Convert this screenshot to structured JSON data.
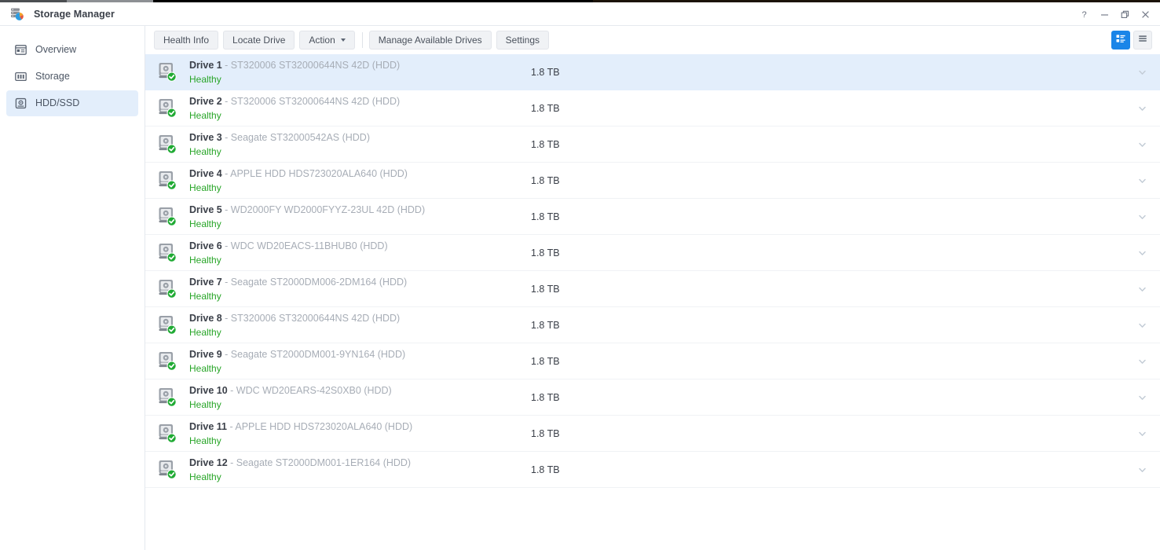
{
  "window": {
    "title": "Storage Manager",
    "app_icon": "storage-manager-icon",
    "controls": [
      {
        "name": "help-button",
        "glyph": "?"
      },
      {
        "name": "minimize-button",
        "glyph": "minimize-icon"
      },
      {
        "name": "maximize-button",
        "glyph": "maximize-icon"
      },
      {
        "name": "close-button",
        "glyph": "close-icon"
      }
    ]
  },
  "sidebar": {
    "items": [
      {
        "label": "Overview",
        "icon": "overview-icon",
        "active": false
      },
      {
        "label": "Storage",
        "icon": "storage-icon",
        "active": false
      },
      {
        "label": "HDD/SSD",
        "icon": "hdd-ssd-icon",
        "active": true
      }
    ]
  },
  "toolbar": {
    "health_info_label": "Health Info",
    "locate_drive_label": "Locate Drive",
    "action_label": "Action",
    "manage_available_drives_label": "Manage Available Drives",
    "settings_label": "Settings",
    "view_detail_icon": "detail-view-icon",
    "view_list_icon": "list-view-icon",
    "active_view": "detail"
  },
  "colors": {
    "accent": "#1a85e8",
    "selected_row": "#e3eefb",
    "healthy": "#27a527",
    "model_text": "#a7adb6",
    "primary_text": "#3b4049"
  },
  "drives": [
    {
      "name": "Drive 1",
      "model": "ST320006 ST32000644NS 42D (HDD)",
      "size": "1.8 TB",
      "status": "Healthy",
      "selected": true
    },
    {
      "name": "Drive 2",
      "model": "ST320006 ST32000644NS 42D (HDD)",
      "size": "1.8 TB",
      "status": "Healthy",
      "selected": false
    },
    {
      "name": "Drive 3",
      "model": "Seagate ST32000542AS (HDD)",
      "size": "1.8 TB",
      "status": "Healthy",
      "selected": false
    },
    {
      "name": "Drive 4",
      "model": "APPLE HDD HDS723020ALA640 (HDD)",
      "size": "1.8 TB",
      "status": "Healthy",
      "selected": false
    },
    {
      "name": "Drive 5",
      "model": "WD2000FY WD2000FYYZ-23UL 42D (HDD)",
      "size": "1.8 TB",
      "status": "Healthy",
      "selected": false
    },
    {
      "name": "Drive 6",
      "model": "WDC WD20EACS-11BHUB0 (HDD)",
      "size": "1.8 TB",
      "status": "Healthy",
      "selected": false
    },
    {
      "name": "Drive 7",
      "model": "Seagate ST2000DM006-2DM164 (HDD)",
      "size": "1.8 TB",
      "status": "Healthy",
      "selected": false
    },
    {
      "name": "Drive 8",
      "model": "ST320006 ST32000644NS 42D (HDD)",
      "size": "1.8 TB",
      "status": "Healthy",
      "selected": false
    },
    {
      "name": "Drive 9",
      "model": "Seagate ST2000DM001-9YN164 (HDD)",
      "size": "1.8 TB",
      "status": "Healthy",
      "selected": false
    },
    {
      "name": "Drive 10",
      "model": "WDC WD20EARS-42S0XB0 (HDD)",
      "size": "1.8 TB",
      "status": "Healthy",
      "selected": false
    },
    {
      "name": "Drive 11",
      "model": "APPLE HDD HDS723020ALA640 (HDD)",
      "size": "1.8 TB",
      "status": "Healthy",
      "selected": false
    },
    {
      "name": "Drive 12",
      "model": "Seagate ST2000DM001-1ER164 (HDD)",
      "size": "1.8 TB",
      "status": "Healthy",
      "selected": false
    }
  ]
}
